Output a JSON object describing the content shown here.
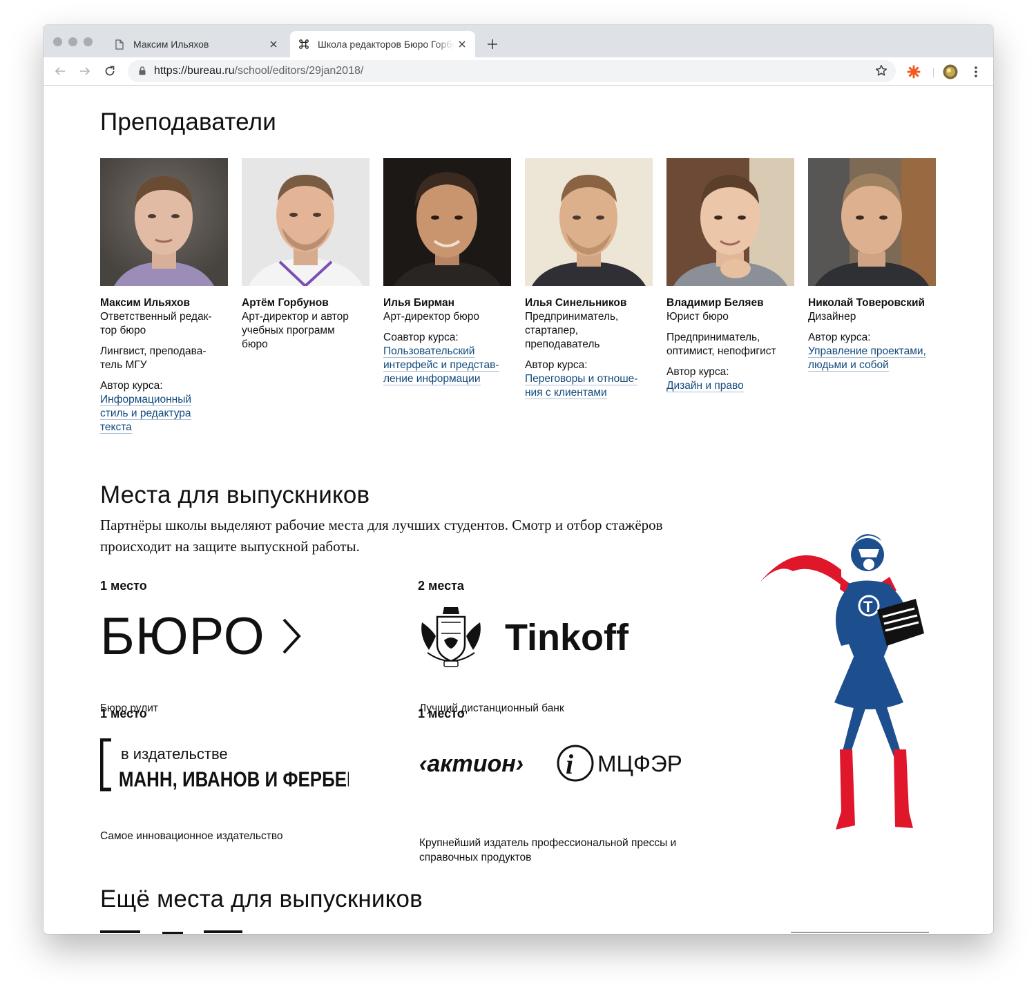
{
  "browser": {
    "tabs": [
      {
        "title": "Максим Ильяхов"
      },
      {
        "title": "Школа редакторов Бюро Горбунова"
      }
    ],
    "url_host": "https://bureau.ru",
    "url_path": "/school/editors/29jan2018/"
  },
  "teachers_section": {
    "title": "Преподаватели",
    "teachers": [
      {
        "name": "Максим Ильяхов",
        "role": "Ответственный редак-тор бюро",
        "note": "Лингвист, преподава-тель МГУ",
        "course_label": "Автор курса:",
        "course": "Информационный стиль и редактура текста"
      },
      {
        "name": "Артём Горбунов",
        "role": "Арт-директор и автор учебных программ бюро",
        "note": "",
        "course_label": "",
        "course": ""
      },
      {
        "name": "Илья Бирман",
        "role": "Арт-директор бюро",
        "note": "",
        "course_label": "Соавтор курса:",
        "course": "Пользовательский интерфейс и представ-ление информации"
      },
      {
        "name": "Илья Синельников",
        "role": "Предприниматель, стартапер, преподаватель",
        "note": "",
        "course_label": "Автор курса:",
        "course": "Переговоры и отноше-ния с клиентами"
      },
      {
        "name": "Владимир Беляев",
        "role": "Юрист бюро",
        "note": "Предприниматель, оптимист, непофигист",
        "course_label": "Автор курса:",
        "course": "Дизайн и право"
      },
      {
        "name": "Николай Товеровский",
        "role": "Дизайнер",
        "note": "",
        "course_label": "Автор курса:",
        "course": "Управление проектами, людьми и собой"
      }
    ]
  },
  "places_section": {
    "title": "Места для выпускников",
    "intro": "Партнёры школы выделяют рабочие места для лучших студентов. Смотр и отбор стажёров происходит на защите выпускной работы.",
    "partners": [
      {
        "count": "1 место",
        "logo_text": "БЮРО",
        "description": "Бюро рулит"
      },
      {
        "count": "2 места",
        "logo_text": "Tinkoff",
        "description": "Лучший дистанционный банк"
      },
      {
        "count": "1 место",
        "logo_line1": "в издательстве",
        "logo_line2": "МАНН, ИВАНОВ И ФЕРБЕР",
        "description": "Самое инновационное издательство"
      },
      {
        "count": "1 место",
        "logo_text": "‹актион›",
        "logo_text2": "МЦФЭР",
        "description": "Крупнейший издатель профессиональной прессы и справочных продуктов"
      }
    ]
  },
  "more_section": {
    "title": "Ещё места для выпускников"
  },
  "colors": {
    "link": "#114a7d",
    "hero_blue": "#1d4f8f",
    "hero_red": "#e0162b",
    "extension_orange": "#f05a22"
  }
}
